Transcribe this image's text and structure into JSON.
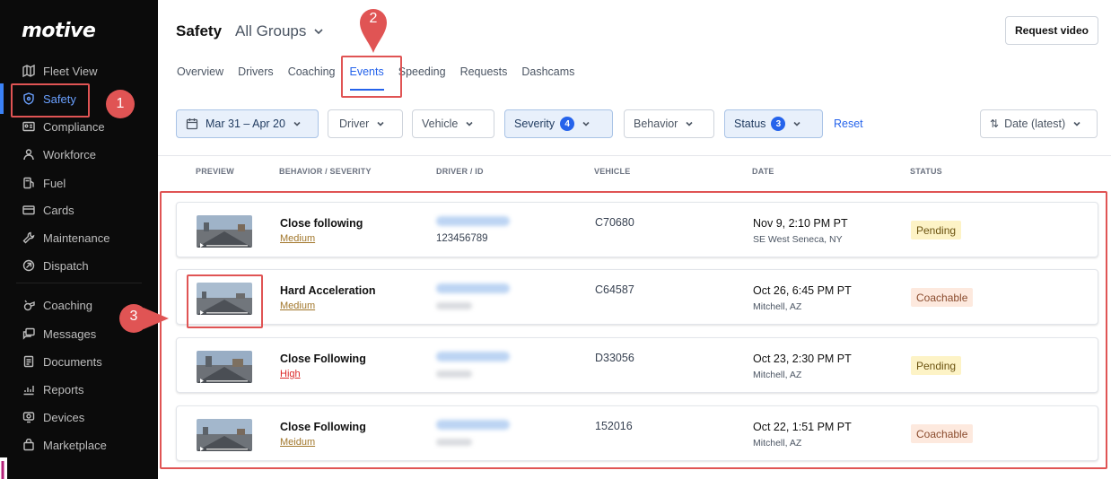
{
  "app": {
    "logo": "motive"
  },
  "sidebar": {
    "items": [
      {
        "label": "Fleet View",
        "icon": "map-icon"
      },
      {
        "label": "Safety",
        "icon": "shield-icon",
        "active": true
      },
      {
        "label": "Compliance",
        "icon": "id-card-icon"
      },
      {
        "label": "Workforce",
        "icon": "person-icon"
      },
      {
        "label": "Fuel",
        "icon": "fuel-pump-icon"
      },
      {
        "label": "Cards",
        "icon": "credit-card-icon"
      },
      {
        "label": "Maintenance",
        "icon": "wrench-icon"
      },
      {
        "label": "Dispatch",
        "icon": "dispatch-icon"
      },
      {
        "label": "Coaching",
        "icon": "whistle-icon"
      },
      {
        "label": "Messages",
        "icon": "chat-icon"
      },
      {
        "label": "Documents",
        "icon": "document-icon"
      },
      {
        "label": "Reports",
        "icon": "chart-icon"
      },
      {
        "label": "Devices",
        "icon": "device-icon"
      },
      {
        "label": "Marketplace",
        "icon": "bag-icon"
      }
    ]
  },
  "header": {
    "title": "Safety",
    "group_select": "All Groups",
    "request_video": "Request video"
  },
  "tabs": [
    {
      "label": "Overview"
    },
    {
      "label": "Drivers"
    },
    {
      "label": "Coaching"
    },
    {
      "label": "Events",
      "active": true
    },
    {
      "label": "Speeding"
    },
    {
      "label": "Requests"
    },
    {
      "label": "Dashcams"
    }
  ],
  "filters": {
    "date_range": "Mar 31 – Apr 20",
    "driver": "Driver",
    "vehicle": "Vehicle",
    "severity": "Severity",
    "severity_count": "4",
    "behavior": "Behavior",
    "status": "Status",
    "status_count": "3",
    "reset": "Reset",
    "sort": "Date (latest)"
  },
  "table": {
    "columns": [
      "PREVIEW",
      "BEHAVIOR / SEVERITY",
      "DRIVER / ID",
      "VEHICLE",
      "DATE",
      "STATUS"
    ],
    "rows": [
      {
        "behavior": "Close following",
        "severity": "Medium",
        "severity_level": "medium",
        "driver_id": "123456789",
        "vehicle": "C70680",
        "date": "Nov 9, 2:10 PM PT",
        "location": "SE West Seneca, NY",
        "status": "Pending",
        "status_kind": "pending"
      },
      {
        "behavior": "Hard Acceleration",
        "severity": "Medium",
        "severity_level": "medium",
        "driver_id": "",
        "vehicle": "C64587",
        "date": "Oct 26, 6:45 PM PT",
        "location": "Mitchell, AZ",
        "status": "Coachable",
        "status_kind": "coachable"
      },
      {
        "behavior": "Close Following",
        "severity": "High",
        "severity_level": "high",
        "driver_id": "",
        "vehicle": "D33056",
        "date": "Oct 23, 2:30 PM PT",
        "location": "Mitchell, AZ",
        "status": "Pending",
        "status_kind": "pending"
      },
      {
        "behavior": "Close Following",
        "severity": "Meidum",
        "severity_level": "medium",
        "driver_id": "",
        "vehicle": "152016",
        "date": "Oct 22, 1:51 PM PT",
        "location": "Mitchell, AZ",
        "status": "Coachable",
        "status_kind": "coachable"
      }
    ]
  },
  "annotations": {
    "markers": [
      "1",
      "2",
      "3"
    ],
    "color": "#e05454"
  },
  "colors": {
    "accent": "#2563eb",
    "sidebar_bg": "#0b0b0b",
    "pending_bg": "#fdf3c6",
    "coachable_bg": "#fde9de"
  }
}
